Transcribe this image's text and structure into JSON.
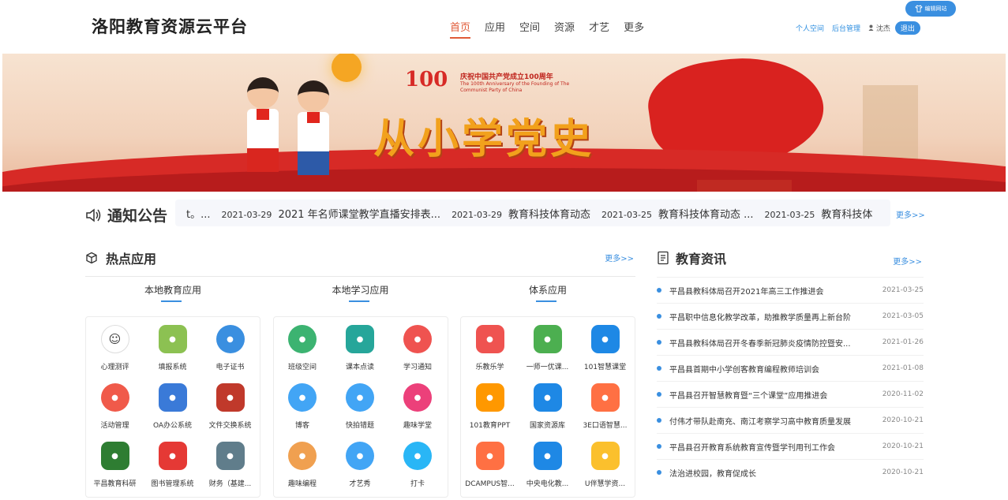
{
  "header": {
    "logo": "洛阳教育资源云平台",
    "nav": [
      "首页",
      "应用",
      "空间",
      "资源",
      "才艺",
      "更多"
    ],
    "nav_active": "首页",
    "personal_space": "个人空间",
    "admin": "后台管理",
    "username": "沈杰",
    "logout": "退出",
    "edit_site": "编辑网站"
  },
  "banner": {
    "anniversary_number": "100",
    "anniversary_cn": "庆祝中国共产党成立100周年",
    "anniversary_en": "The 100th Anniversary of the Founding of The Communist Party of China",
    "slogan": "从小学党史"
  },
  "notice": {
    "title": "通知公告",
    "more": "更多>>",
    "items": [
      {
        "date": "",
        "title": "t。..."
      },
      {
        "date": "2021-03-29",
        "title": "2021 年名师课堂教学直播安排表..."
      },
      {
        "date": "2021-03-29",
        "title": "教育科技体育动态"
      },
      {
        "date": "2021-03-25",
        "title": "教育科技体育动态 ..."
      },
      {
        "date": "2021-03-25",
        "title": "教育科技体"
      }
    ]
  },
  "hot_apps": {
    "title": "热点应用",
    "more": "更多>>",
    "columns": [
      {
        "title": "本地教育应用",
        "apps": [
          {
            "label": "心理测评",
            "icon": "smile-icon",
            "color": "#ffffff"
          },
          {
            "label": "填报系统",
            "icon": "book-icon",
            "color": "#8cc152"
          },
          {
            "label": "电子证书",
            "icon": "certificate-icon",
            "color": "#3a8fe0"
          },
          {
            "label": "活动管理",
            "icon": "pinwheel-icon",
            "color": "#f05a4a"
          },
          {
            "label": "OA办公系统",
            "icon": "ie-bag-icon",
            "color": "#3a7ad8"
          },
          {
            "label": "文件交换系统",
            "icon": "exchange-icon",
            "color": "#c0392b"
          },
          {
            "label": "平昌教育科研",
            "icon": "research-icon",
            "color": "#2e7d32"
          },
          {
            "label": "图书管理系统",
            "icon": "library-icon",
            "color": "#e53935"
          },
          {
            "label": "财务（基建...",
            "icon": "building-icon",
            "color": "#607d8b"
          }
        ]
      },
      {
        "title": "本地学习应用",
        "apps": [
          {
            "label": "班级空间",
            "icon": "clover-icon",
            "color": "#3cb371"
          },
          {
            "label": "课本点读",
            "icon": "reader-icon",
            "color": "#26a69a"
          },
          {
            "label": "学习通知",
            "icon": "notice-icon",
            "color": "#ef5350"
          },
          {
            "label": "博客",
            "icon": "blog-icon",
            "color": "#42a5f5"
          },
          {
            "label": "快拍错题",
            "icon": "camera-icon",
            "color": "#42a5f5"
          },
          {
            "label": "趣味学堂",
            "icon": "crayon-icon",
            "color": "#ec407a"
          },
          {
            "label": "趣味编程",
            "icon": "code-icon",
            "color": "#f0a050"
          },
          {
            "label": "才艺秀",
            "icon": "show-icon",
            "color": "#42a5f5"
          },
          {
            "label": "打卡",
            "icon": "checkin-icon",
            "color": "#29b6f6"
          }
        ]
      },
      {
        "title": "体系应用",
        "apps": [
          {
            "label": "乐教乐学",
            "icon": "music-icon",
            "color": "#ef5350"
          },
          {
            "label": "一师一优课...",
            "icon": "lesson-icon",
            "color": "#4caf50"
          },
          {
            "label": "101智慧课堂",
            "icon": "smart-class-icon",
            "color": "#1e88e5"
          },
          {
            "label": "101教育PPT",
            "icon": "ppt-icon",
            "color": "#ff9800"
          },
          {
            "label": "国家资源库",
            "icon": "graduation-icon",
            "color": "#1e88e5"
          },
          {
            "label": "3E口语智慧...",
            "icon": "speech-icon",
            "color": "#ff7043"
          },
          {
            "label": "DCAMPUS智...",
            "icon": "dcampus-icon",
            "color": "#ff7043"
          },
          {
            "label": "中央电化教...",
            "icon": "ncet-icon",
            "color": "#1e88e5"
          },
          {
            "label": "U伴慧学资...",
            "icon": "star-icon",
            "color": "#fbc02d"
          }
        ]
      }
    ]
  },
  "news": {
    "title": "教育资讯",
    "more": "更多>>",
    "items": [
      {
        "title": "平昌县教科体局召开2021年高三工作推进会",
        "date": "2021-03-25"
      },
      {
        "title": "平昌职中信息化教学改革，助推教学质量再上新台阶",
        "date": "2021-03-05"
      },
      {
        "title": "平昌县教科体局召开冬春季新冠肺炎疫情防控暨安...",
        "date": "2021-01-26"
      },
      {
        "title": "平昌县首期中小学创客教育编程教师培训会",
        "date": "2021-01-08"
      },
      {
        "title": "平昌县召开智慧教育暨“三个课堂”应用推进会",
        "date": "2020-11-02"
      },
      {
        "title": "付伟才带队赴南充、南江考察学习高中教育质量发展",
        "date": "2020-10-21"
      },
      {
        "title": "平昌县召开教育系统教育宣传暨学刊用刊工作会",
        "date": "2020-10-21"
      },
      {
        "title": "法治进校园，教育促成长",
        "date": "2020-10-21"
      }
    ]
  }
}
